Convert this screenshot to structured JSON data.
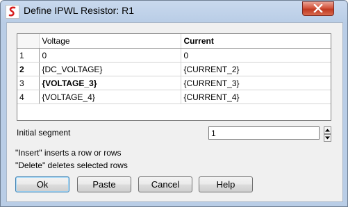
{
  "window": {
    "title": "Define IPWL Resistor: R1"
  },
  "icons": {
    "app": "simetrix-logo-icon",
    "close": "close-icon",
    "spin_up": "spin-up-icon",
    "spin_down": "spin-down-icon"
  },
  "colors": {
    "close_button": "#c13a22",
    "title_bar": "#b9cde6",
    "default_button_border": "#3c7fb1"
  },
  "table": {
    "headers": {
      "voltage": "Voltage",
      "current": "Current"
    },
    "rows": [
      {
        "num": "1",
        "voltage": "0",
        "current": "0"
      },
      {
        "num": "2",
        "voltage": "{DC_VOLTAGE}",
        "current": "{CURRENT_2}"
      },
      {
        "num": "3",
        "voltage": "{VOLTAGE_3}",
        "current": "{CURRENT_3}"
      },
      {
        "num": "4",
        "voltage": "{VOLTAGE_4}",
        "current": "{CURRENT_4}"
      }
    ]
  },
  "initial_segment": {
    "label": "Initial segment",
    "value": "1"
  },
  "help": {
    "insert_text": "\"Insert\" inserts a row or rows",
    "delete_text": "\"Delete\" deletes selected rows"
  },
  "buttons": {
    "ok": "Ok",
    "paste": "Paste",
    "cancel": "Cancel",
    "help": "Help"
  }
}
